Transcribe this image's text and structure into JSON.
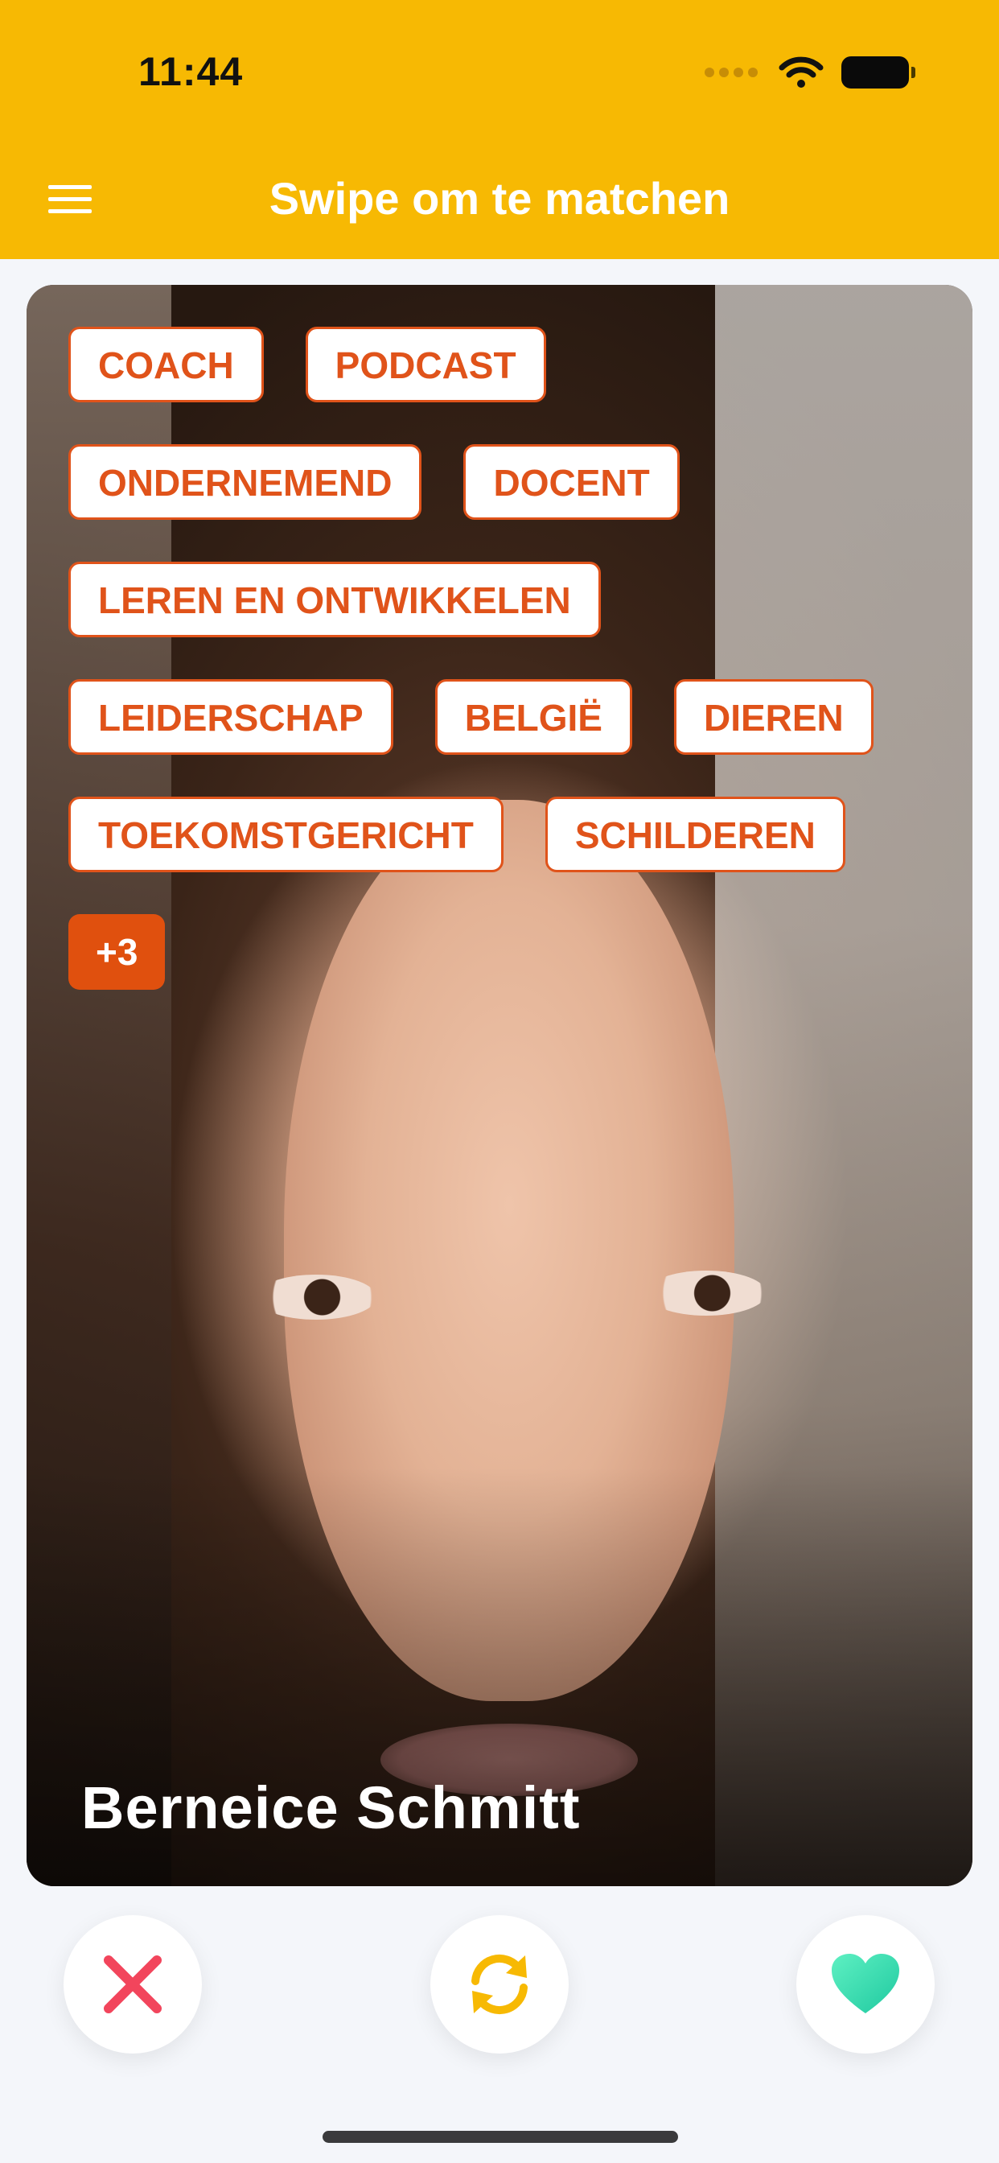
{
  "status_bar": {
    "time": "11:44"
  },
  "header": {
    "title": "Swipe om te matchen"
  },
  "profile": {
    "name": "Berneice Schmitt",
    "tag_rows": [
      [
        "COACH",
        "PODCAST"
      ],
      [
        "ONDERNEMEND",
        "DOCENT"
      ],
      [
        "LEREN EN ONTWIKKELEN"
      ],
      [
        "LEIDERSCHAP",
        "BELGIË",
        "DIEREN"
      ],
      [
        "TOEKOMSTGERICHT",
        "SCHILDEREN"
      ]
    ],
    "more_tags": "+3"
  },
  "actions": {
    "dislike_icon": "close-icon",
    "refresh_icon": "refresh-icon",
    "like_icon": "heart-icon"
  },
  "colors": {
    "brand": "#f7b903",
    "tag": "#e0531a",
    "dislike": "#f2455c",
    "refresh": "#f7b903",
    "like": "#3ee0b4"
  }
}
